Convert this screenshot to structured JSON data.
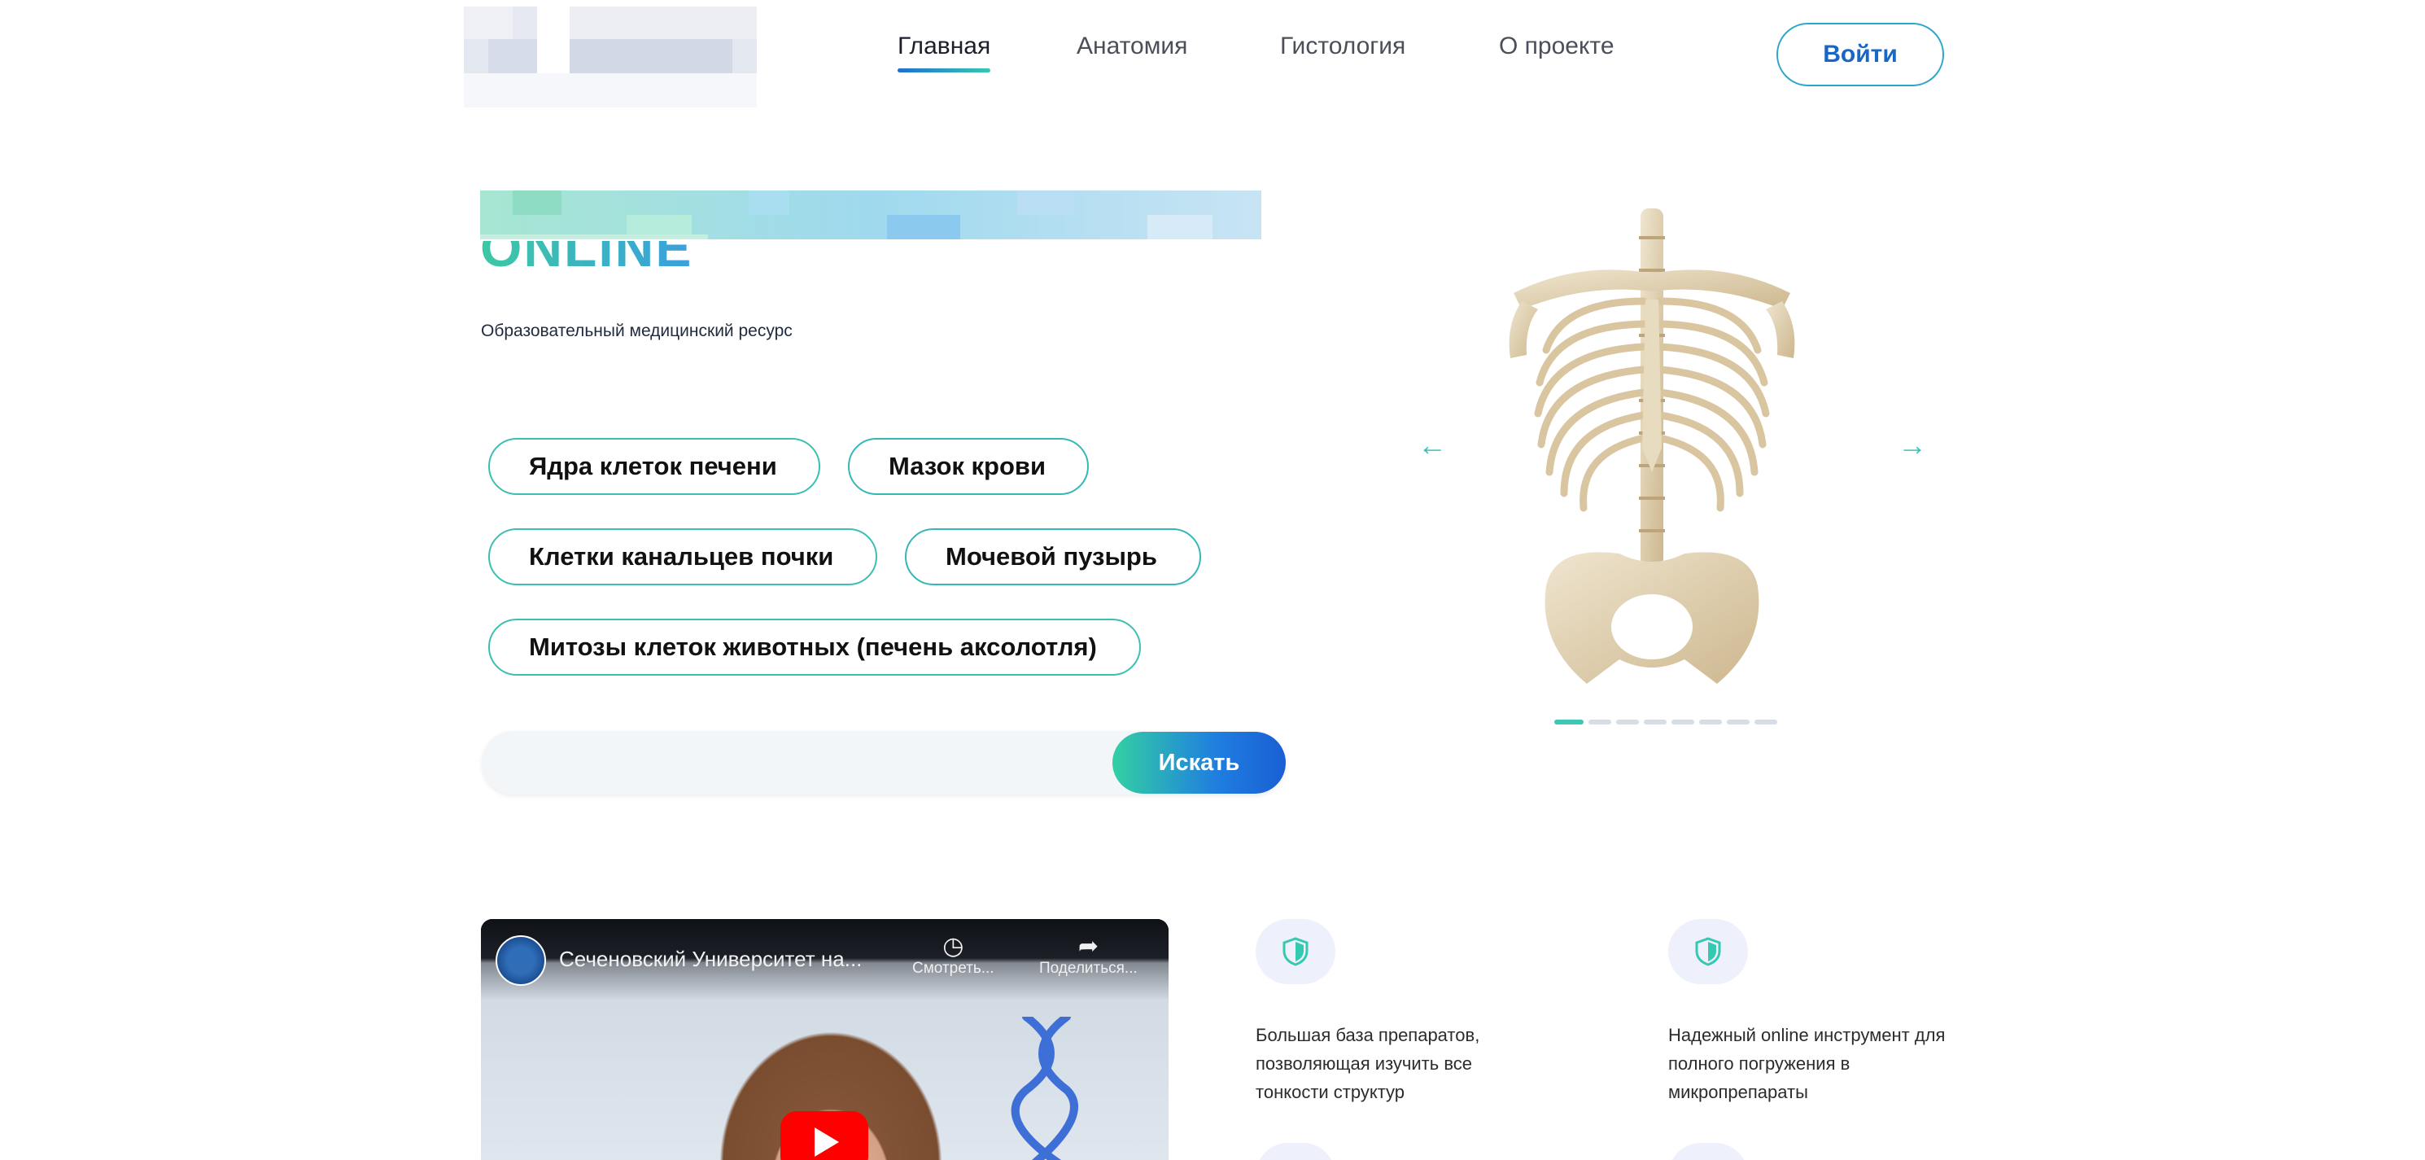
{
  "header": {
    "nav": [
      {
        "label": "Главная",
        "active": true
      },
      {
        "label": "Анатомия",
        "active": false
      },
      {
        "label": "Гистология",
        "active": false
      },
      {
        "label": "О проекте",
        "active": false
      }
    ],
    "login_label": "Войти"
  },
  "hero": {
    "title_visible": "ONLINE",
    "subtitle": "Образовательный медицинский ресурс",
    "chips": [
      "Ядра клеток печени",
      "Мазок крови",
      "Клетки канальцев почки",
      "Мочевой пузырь",
      "Митозы клеток животных (печень аксолотля)"
    ],
    "search_placeholder": "",
    "search_button": "Искать"
  },
  "carousel": {
    "prev_arrow": "←",
    "next_arrow": "→",
    "slide_count": 8,
    "active_slide": 1
  },
  "video": {
    "title": "Сеченовский Университет на...",
    "watch_later": "Смотреть...",
    "share": "Поделиться..."
  },
  "features": [
    {
      "text": "Большая база препаратов, позволяющая изучить все тонкости структур"
    },
    {
      "text": "Надежный online инструмент для полного погружения в микропрепараты"
    }
  ],
  "colors": {
    "accent_teal": "#36c9b2",
    "accent_blue": "#1f6fd0",
    "feature_icon_bg": "#eef0fb"
  }
}
